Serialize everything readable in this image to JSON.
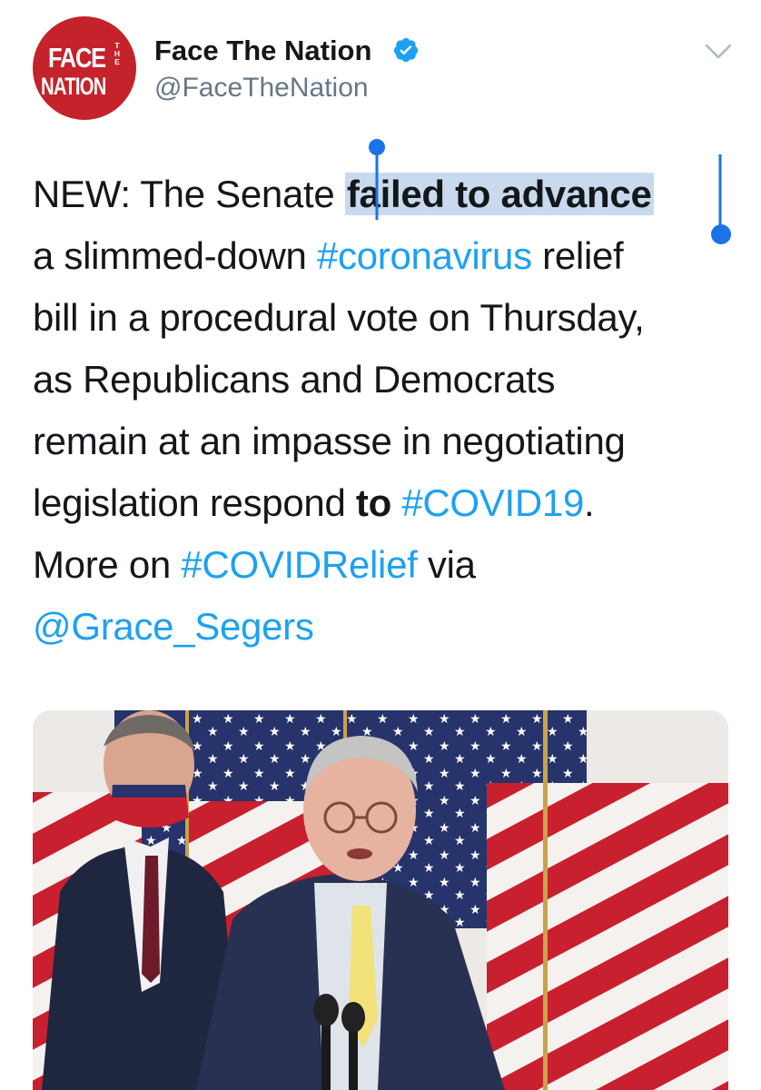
{
  "account": {
    "logo_line1": "FACE",
    "logo_line2": "THE",
    "logo_line3": "NATION",
    "display_name": "Face The Nation",
    "handle": "@FaceTheNation",
    "verified": true
  },
  "tweet": {
    "line1_pre": "NEW: The Senate ",
    "line1_sel": "failed to advance",
    "line2_pre": "a slimmed-down ",
    "line2_tag": "#coronavirus",
    "line2_post": " relief",
    "line3": "bill in a procedural vote on Thursday,",
    "line4": "as Republicans and Democrats",
    "line5": "remain at an impasse in negotiating",
    "line6_pre": "legislation respond ",
    "line6_bold": "to",
    "line6_space": " ",
    "line6_tag": "#COVID19",
    "line6_post": ".",
    "line7_pre": "More on ",
    "line7_tag": "#COVIDRelief",
    "line7_post": " via",
    "line8_mention": "@Grace_Segers"
  },
  "colors": {
    "link": "#1da1f2",
    "selection": "#c9daee",
    "selection_handle": "#1a73e8",
    "brand_red": "#c4232b",
    "handle_gray": "#657786"
  },
  "icons": {
    "verified": "verified-badge-icon",
    "menu": "chevron-down-icon"
  }
}
